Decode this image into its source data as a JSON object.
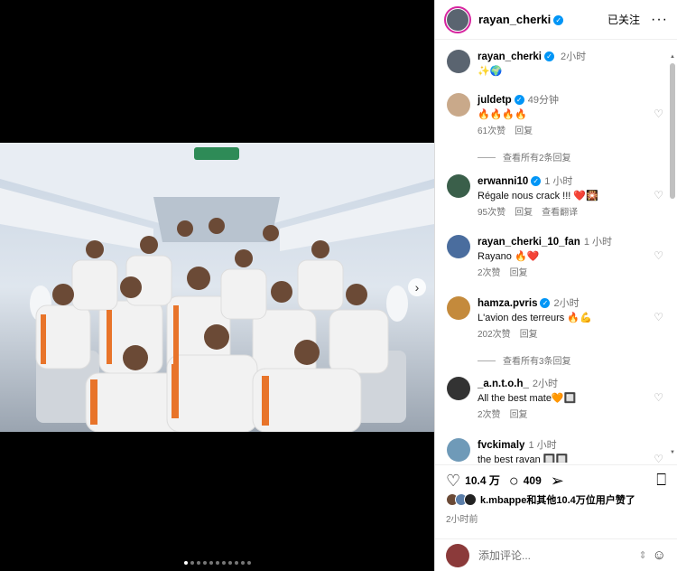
{
  "post": {
    "author": "rayan_cherki",
    "follow_label": "已关注",
    "more_label": "···",
    "caption": {
      "user": "rayan_cherki",
      "time": "2小时",
      "text": "✨🌍"
    },
    "carousel": {
      "total": 11,
      "active": 0
    },
    "likes_text": "k.mbappe和其他10.4万位用户赞了",
    "posted_time": "2小时前",
    "actions": {
      "likes": "10.4 万",
      "comments": "409"
    },
    "add_comment_placeholder": "添加评论...",
    "next_icon": "›"
  },
  "comments": [
    {
      "user": "juldetp",
      "verified": true,
      "time": "49分钟",
      "text": "🔥🔥🔥🔥",
      "likes": "61次赞",
      "reply": "回复",
      "translate": "",
      "avatar_color": "#c9a98a"
    },
    {
      "user": "erwanni10",
      "verified": true,
      "time": "1 小时",
      "text": "Régale nous crack !!! ❤️🎇",
      "likes": "95次赞",
      "reply": "回复",
      "translate": "查看翻译",
      "avatar_color": "#3a5f4a"
    },
    {
      "user": "rayan_cherki_10_fan",
      "verified": false,
      "time": "1 小时",
      "text": "Rayano 🔥❤️",
      "likes": "2次赞",
      "reply": "回复",
      "translate": "",
      "avatar_color": "#4a6d9e"
    },
    {
      "user": "hamza.pvris",
      "verified": true,
      "time": "2小时",
      "text": "L'avion des terreurs 🔥💪",
      "likes": "202次赞",
      "reply": "回复",
      "translate": "",
      "avatar_color": "#c48a3c"
    },
    {
      "user": "_a.n.t.o.h_",
      "verified": false,
      "time": "2小时",
      "text": "All the best mate🧡🔲",
      "likes": "2次赞",
      "reply": "回复",
      "translate": "",
      "avatar_color": "#333333"
    },
    {
      "user": "fvckimaly",
      "verified": false,
      "time": "1 小时",
      "text": "the best rayan 🔲🔲",
      "likes": "",
      "reply": "",
      "translate": "",
      "avatar_color": "#6f9ab8"
    }
  ],
  "view_replies": [
    "查看所有2条回复",
    "查看所有3条回复"
  ],
  "colors": {
    "accent": "#0095f6",
    "story_ring": "#d6249f",
    "muted": "#737373"
  }
}
